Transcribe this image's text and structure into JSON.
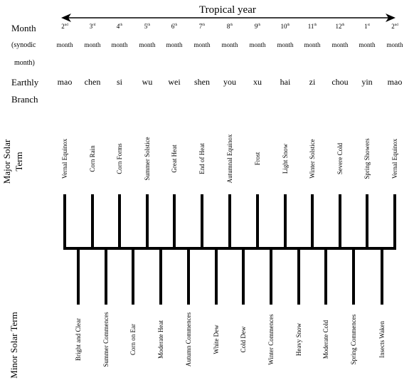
{
  "header": {
    "title": "Tropical year",
    "arrow": "bidirectional-arrow"
  },
  "row_labels": {
    "month": "Month",
    "synodic_1": "(synodic",
    "synodic_2": "month)",
    "earthly_1": "Earthly",
    "earthly_2": "Branch",
    "major": [
      "Major Solar",
      "Term"
    ],
    "minor": "Minor Solar Term"
  },
  "months": [
    {
      "num": "2",
      "suffix": "nd",
      "unit": "month",
      "branch": "mao",
      "major": "Vernal Equinox"
    },
    {
      "num": "3",
      "suffix": "rd",
      "unit": "month",
      "branch": "chen",
      "major": "Corn Rain"
    },
    {
      "num": "4",
      "suffix": "th",
      "unit": "month",
      "branch": "si",
      "major": "Corn Forms"
    },
    {
      "num": "5",
      "suffix": "th",
      "unit": "month",
      "branch": "wu",
      "major": "Summer Solstice"
    },
    {
      "num": "6",
      "suffix": "th",
      "unit": "month",
      "branch": "wei",
      "major": "Great Heat"
    },
    {
      "num": "7",
      "suffix": "th",
      "unit": "month",
      "branch": "shen",
      "major": "End of Heat"
    },
    {
      "num": "8",
      "suffix": "th",
      "unit": "month",
      "branch": "you",
      "major": "Autumnal Equinox"
    },
    {
      "num": "9",
      "suffix": "th",
      "unit": "month",
      "branch": "xu",
      "major": "Frost"
    },
    {
      "num": "10",
      "suffix": "th",
      "unit": "month",
      "branch": "hai",
      "major": "Light Snow"
    },
    {
      "num": "11",
      "suffix": "th",
      "unit": "month",
      "branch": "zi",
      "major": "Winter Solstice"
    },
    {
      "num": "12",
      "suffix": "th",
      "unit": "month",
      "branch": "chou",
      "major": "Severe Cold"
    },
    {
      "num": "1",
      "suffix": "st",
      "unit": "month",
      "branch": "yin",
      "major": "Spring Showers"
    },
    {
      "num": "2",
      "suffix": "nd",
      "unit": "month",
      "branch": "mao",
      "major": "Vernal Equinox"
    }
  ],
  "minor_terms": [
    "Bright and Clear",
    "Summer Commences",
    "Corn on Ear",
    "Moderate Heat",
    "Autumn Commences",
    "White Dew",
    "Cold Dew",
    "Winter Commences",
    "Heavy Snow",
    "Moderate Cold",
    "Spring Commences",
    "Insects Waken"
  ]
}
